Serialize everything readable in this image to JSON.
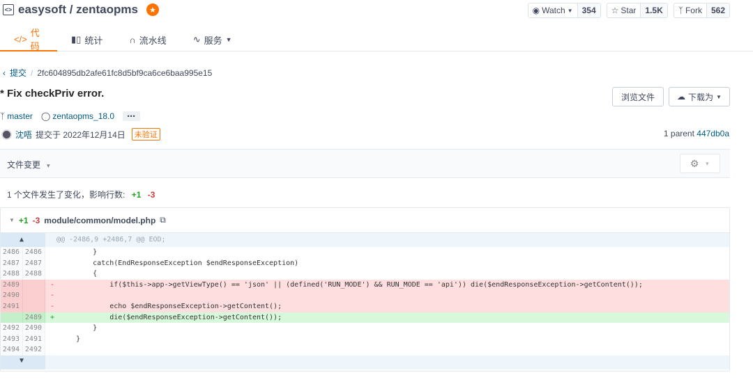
{
  "repo": {
    "title": "easysoft / zentaopms"
  },
  "actions": [
    {
      "label": "Watch",
      "count": "354"
    },
    {
      "label": "Star",
      "count": "1.5K"
    },
    {
      "label": "Fork",
      "count": "562"
    }
  ],
  "tabs": [
    {
      "label": "代码",
      "icon": "code-icon"
    },
    {
      "label": "统计",
      "icon": "bar-chart-icon"
    },
    {
      "label": "流水线",
      "icon": "pipeline-icon"
    },
    {
      "label": "服务",
      "icon": "pulse-icon"
    }
  ],
  "breadcrumb": {
    "back": "提交",
    "hash": "2fc604895db2afe61fc8d5bf9ca6ce6baa995e15"
  },
  "commit": {
    "title": "* Fix checkPriv error.",
    "branch": "master",
    "tag": "zentaopms_18.0",
    "more": "⋯",
    "author": "沈唔",
    "date": "提交于 2022年12月14日",
    "verify": "未验证",
    "parent_label": "1 parent",
    "parent_hash": "447db0a"
  },
  "buttons": {
    "browse": "浏览文件",
    "download": "下载为"
  },
  "files": {
    "label": "文件变更",
    "summary": "1 个文件发生了变化，影响行数:",
    "add": "+1",
    "del": "-3"
  },
  "diff": {
    "add": "+1",
    "del": "-3",
    "path": "module/common/model.php",
    "hunk": "@@ -2486,9 +2486,7 @@ EOD;",
    "lines": [
      {
        "t": "ctx",
        "o": "2486",
        "n": "2486",
        "s": "",
        "c": "        }"
      },
      {
        "t": "ctx",
        "o": "2487",
        "n": "2487",
        "s": "",
        "c": "        catch(EndResponseException $endResponseException)"
      },
      {
        "t": "ctx",
        "o": "2488",
        "n": "2488",
        "s": "",
        "c": "        {"
      },
      {
        "t": "del",
        "o": "2489",
        "n": "",
        "s": "-",
        "c": "            if($this->app->getViewType() == 'json' || (defined('RUN_MODE') && RUN_MODE == 'api')) die($endResponseException->getContent());"
      },
      {
        "t": "del",
        "o": "2490",
        "n": "",
        "s": "-",
        "c": ""
      },
      {
        "t": "del",
        "o": "2491",
        "n": "",
        "s": "-",
        "c": "            echo $endResponseException->getContent();"
      },
      {
        "t": "add",
        "o": "",
        "n": "2489",
        "s": "+",
        "c": "            die($endResponseException->getContent());"
      },
      {
        "t": "ctx",
        "o": "2492",
        "n": "2490",
        "s": "",
        "c": "        }"
      },
      {
        "t": "ctx",
        "o": "2493",
        "n": "2491",
        "s": "",
        "c": "    }"
      },
      {
        "t": "ctx",
        "o": "2494",
        "n": "2492",
        "s": "",
        "c": ""
      }
    ]
  }
}
